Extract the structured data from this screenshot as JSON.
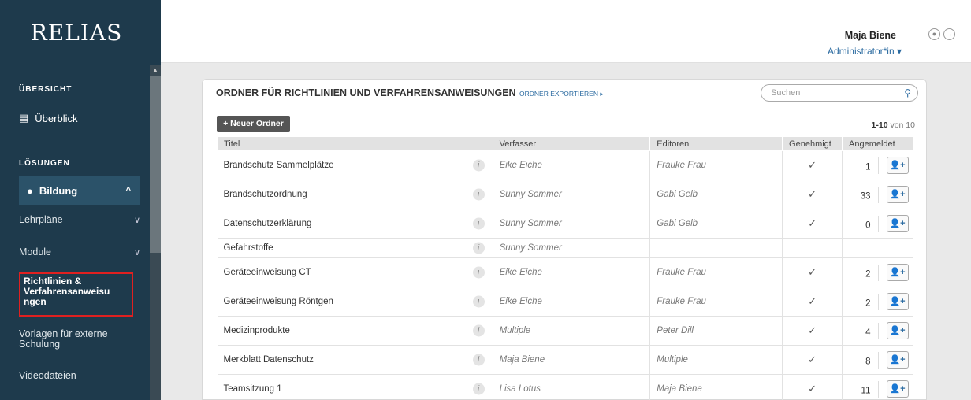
{
  "sidebar": {
    "logo": "RELIAS",
    "sections": {
      "overview_title": "ÜBERSICHT",
      "overview_item": "Überblick",
      "solutions_title": "LÖSUNGEN"
    },
    "bildung": {
      "label": "Bildung",
      "chevron": "^"
    },
    "items": [
      {
        "label": "Lehrpläne",
        "chevron": "∨"
      },
      {
        "label": "Module",
        "chevron": "∨"
      },
      {
        "label": "Richtlinien & Verfahrensanweisu ngen"
      },
      {
        "label": "Vorlagen für externe Schulung"
      },
      {
        "label": "Videodateien"
      }
    ]
  },
  "header": {
    "user_name": "Maja Biene",
    "user_role": "Administrator*in ▾",
    "icons": [
      "user-circle-icon",
      "logout-icon"
    ]
  },
  "panel": {
    "title": "ORDNER FÜR RICHTLINIEN UND VERFAHRENSANWEISUNGEN",
    "export_link": "ORDNER EXPORTIEREN ▸",
    "search_placeholder": "Suchen",
    "new_button": "+ Neuer Ordner",
    "count_range": "1-10",
    "count_suffix": " von 10"
  },
  "table": {
    "headers": [
      "Titel",
      "Verfasser",
      "Editoren",
      "Genehmigt",
      "Angemeldet"
    ],
    "rows": [
      {
        "title": "Brandschutz Sammelplätze",
        "author": "Eike Eiche",
        "editor": "Frauke Frau",
        "approved": "✓",
        "registered": "1"
      },
      {
        "title": "Brandschutzordnung",
        "author": "Sunny Sommer",
        "editor": "Gabi Gelb",
        "approved": "✓",
        "registered": "33"
      },
      {
        "title": "Datenschutzerklärung",
        "author": "Sunny Sommer",
        "editor": "Gabi Gelb",
        "approved": "✓",
        "registered": "0"
      },
      {
        "title": "Gefahrstoffe",
        "author": "Sunny Sommer",
        "editor": "",
        "approved": "",
        "registered": ""
      },
      {
        "title": "Geräteeinweisung CT",
        "author": "Eike Eiche",
        "editor": "Frauke Frau",
        "approved": "✓",
        "registered": "2"
      },
      {
        "title": "Geräteeinweisung Röntgen",
        "author": "Eike Eiche",
        "editor": "Frauke Frau",
        "approved": "✓",
        "registered": "2"
      },
      {
        "title": "Medizinprodukte",
        "author": "Multiple",
        "editor": "Peter Dill",
        "approved": "✓",
        "registered": "4"
      },
      {
        "title": "Merkblatt Datenschutz",
        "author": "Maja Biene",
        "editor": "Multiple",
        "approved": "✓",
        "registered": "8"
      },
      {
        "title": "Teamsitzung 1",
        "author": "Lisa Lotus",
        "editor": "Maja Biene",
        "approved": "✓",
        "registered": "11"
      }
    ]
  },
  "colors": {
    "sidebar": "#1e3a4c",
    "accent": "#2a6aa0",
    "highlight": "#e02020"
  }
}
